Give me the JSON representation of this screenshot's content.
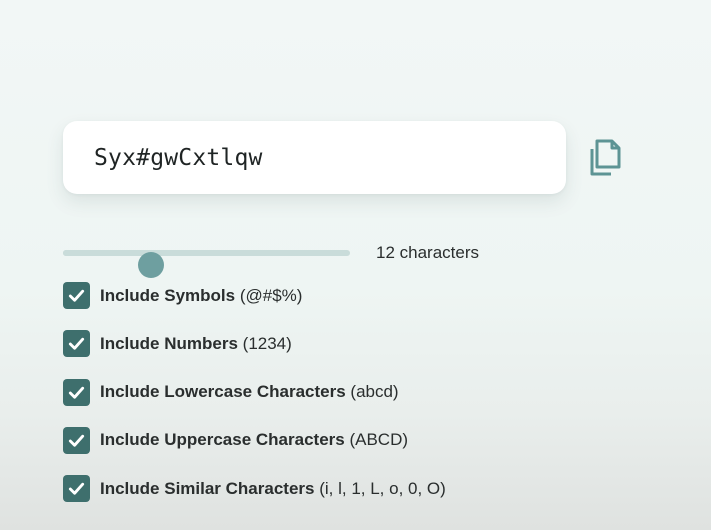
{
  "password": {
    "value": "Syx#gwCxtlqw"
  },
  "copy": {
    "icon": "copy-icon"
  },
  "length": {
    "value": 12,
    "min": 4,
    "max": 30,
    "label": "12 characters"
  },
  "options": [
    {
      "bold": "Include Symbols",
      "hint": "(@#$%)",
      "checked": true
    },
    {
      "bold": "Include Numbers",
      "hint": "(1234)",
      "checked": true
    },
    {
      "bold": "Include Lowercase Characters",
      "hint": "(abcd)",
      "checked": true
    },
    {
      "bold": "Include Uppercase Characters",
      "hint": "(ABCD)",
      "checked": true
    },
    {
      "bold": "Include Similar Characters",
      "hint": "(i, l, 1, L, o, 0, O)",
      "checked": true
    }
  ],
  "colors": {
    "accent": "#3e6f6d",
    "slider_thumb": "#6e9fa0",
    "slider_track": "#c9dcda",
    "copy_icon": "#5d9494"
  }
}
